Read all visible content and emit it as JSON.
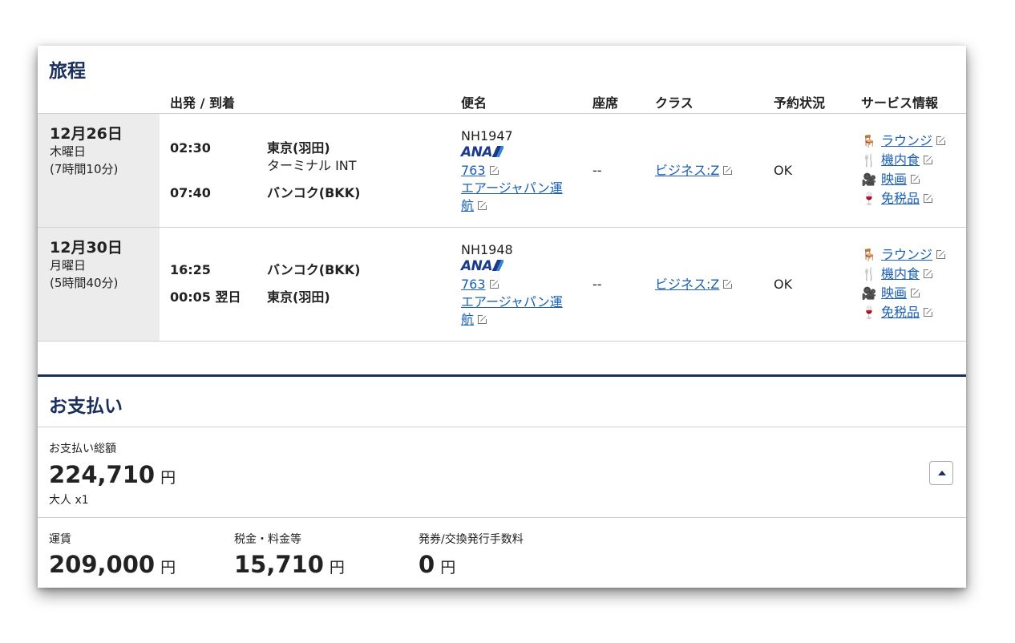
{
  "itinerary": {
    "title": "旅程",
    "headers": {
      "dep_arr": "出発 / 到着",
      "flight": "便名",
      "seat": "座席",
      "class": "クラス",
      "status": "予約状況",
      "service": "サービス情報"
    },
    "rows": [
      {
        "date": "12月26日",
        "weekday": "木曜日",
        "duration": "(7時間10分)",
        "dep_time": "02:30",
        "dep_place": "東京(羽田)",
        "dep_terminal": "ターミナル INT",
        "arr_time": "07:40",
        "arr_place": "バンコク(BKK)",
        "flight_no": "NH1947",
        "airline_logo": "ANA",
        "aircraft": "763",
        "operator_1": "エアージャパン運",
        "operator_2": "航",
        "seat": "--",
        "class": "ビジネス:Z",
        "status": "OK"
      },
      {
        "date": "12月30日",
        "weekday": "月曜日",
        "duration": "(5時間40分)",
        "dep_time": "16:25",
        "dep_place": "バンコク(BKK)",
        "arr_time": "00:05 翌日",
        "arr_place": "東京(羽田)",
        "flight_no": "NH1948",
        "airline_logo": "ANA",
        "aircraft": "763",
        "operator_1": "エアージャパン運",
        "operator_2": "航",
        "seat": "--",
        "class": "ビジネス:Z",
        "status": "OK"
      }
    ],
    "services": [
      "ラウンジ",
      "機内食",
      "映画",
      "免税品"
    ],
    "service_icons": [
      "lounge-icon",
      "meal-icon",
      "movie-icon",
      "duty-free-icon"
    ]
  },
  "payment": {
    "title": "お支払い",
    "total_label": "お支払い総額",
    "total_amount": "224,710",
    "total_unit": "円",
    "passengers": "大人 x1",
    "fare_label": "運賃",
    "fare_amount": "209,000",
    "tax_label": "税金・料金等",
    "tax_amount": "15,710",
    "fee_label": "発券/交換発行手数料",
    "fee_amount": "0",
    "unit": "円"
  },
  "colors": {
    "accent": "#1a2f5c",
    "link": "#1a5fb4",
    "date_bg": "#ececec"
  }
}
